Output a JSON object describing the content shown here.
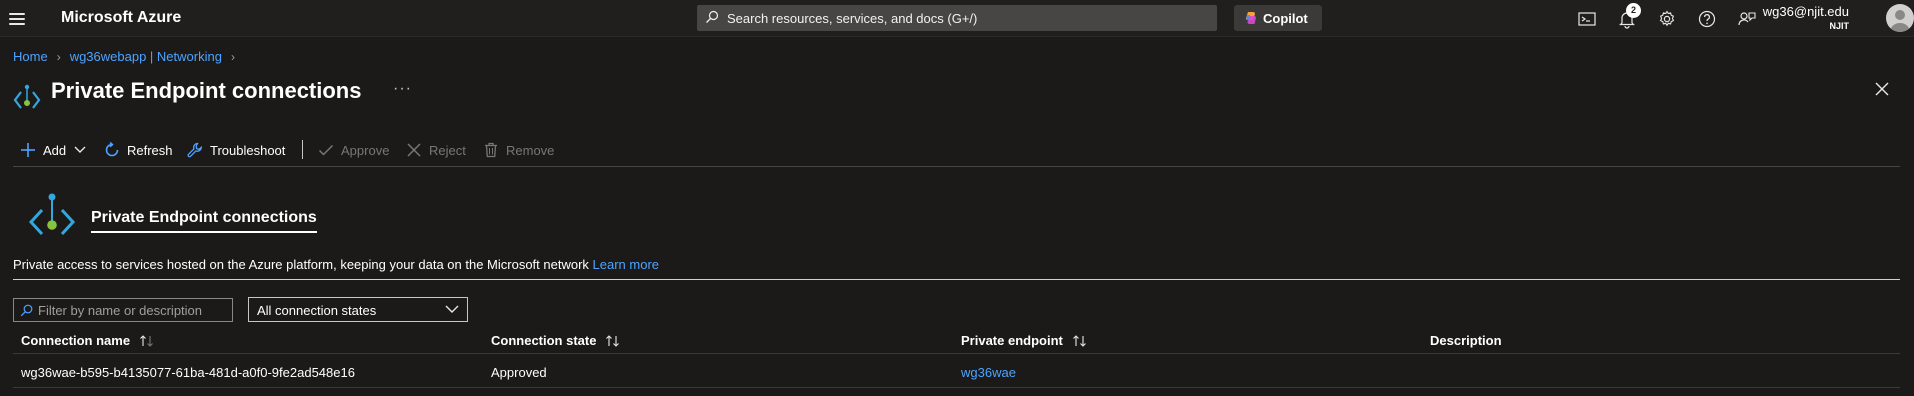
{
  "app": {
    "title": "Microsoft Azure",
    "search_placeholder": "Search resources, services, and docs (G+/)",
    "copilot_label": "Copilot",
    "notification_count": "2",
    "account_email": "wg36@njit.edu",
    "account_org": "NJIT"
  },
  "breadcrumb": {
    "items": [
      "Home",
      "wg36webapp | Networking"
    ]
  },
  "page": {
    "title": "Private Endpoint connections",
    "more_label": "···"
  },
  "toolbar": {
    "add_label": "Add",
    "refresh_label": "Refresh",
    "troubleshoot_label": "Troubleshoot",
    "approve_label": "Approve",
    "reject_label": "Reject",
    "remove_label": "Remove"
  },
  "section": {
    "title": "Private Endpoint connections",
    "description": "Private access to services hosted on the Azure platform, keeping your data on the Microsoft network",
    "learn_more": "Learn more"
  },
  "filters": {
    "search_placeholder": "Filter by name or description",
    "state_value": "All connection states"
  },
  "table": {
    "columns": [
      "Connection name",
      "Connection state",
      "Private endpoint",
      "Description"
    ],
    "rows": [
      {
        "name": "wg36wae-b595-b4135077-61ba-481d-a0f0-9fe2ad548e16",
        "state": "Approved",
        "endpoint": "wg36wae",
        "description": ""
      }
    ]
  },
  "colors": {
    "background": "#1b1a19",
    "topbar": "#201f1e",
    "link": "#4da3ff",
    "disabled": "#797775",
    "accent": "#0078d4"
  }
}
